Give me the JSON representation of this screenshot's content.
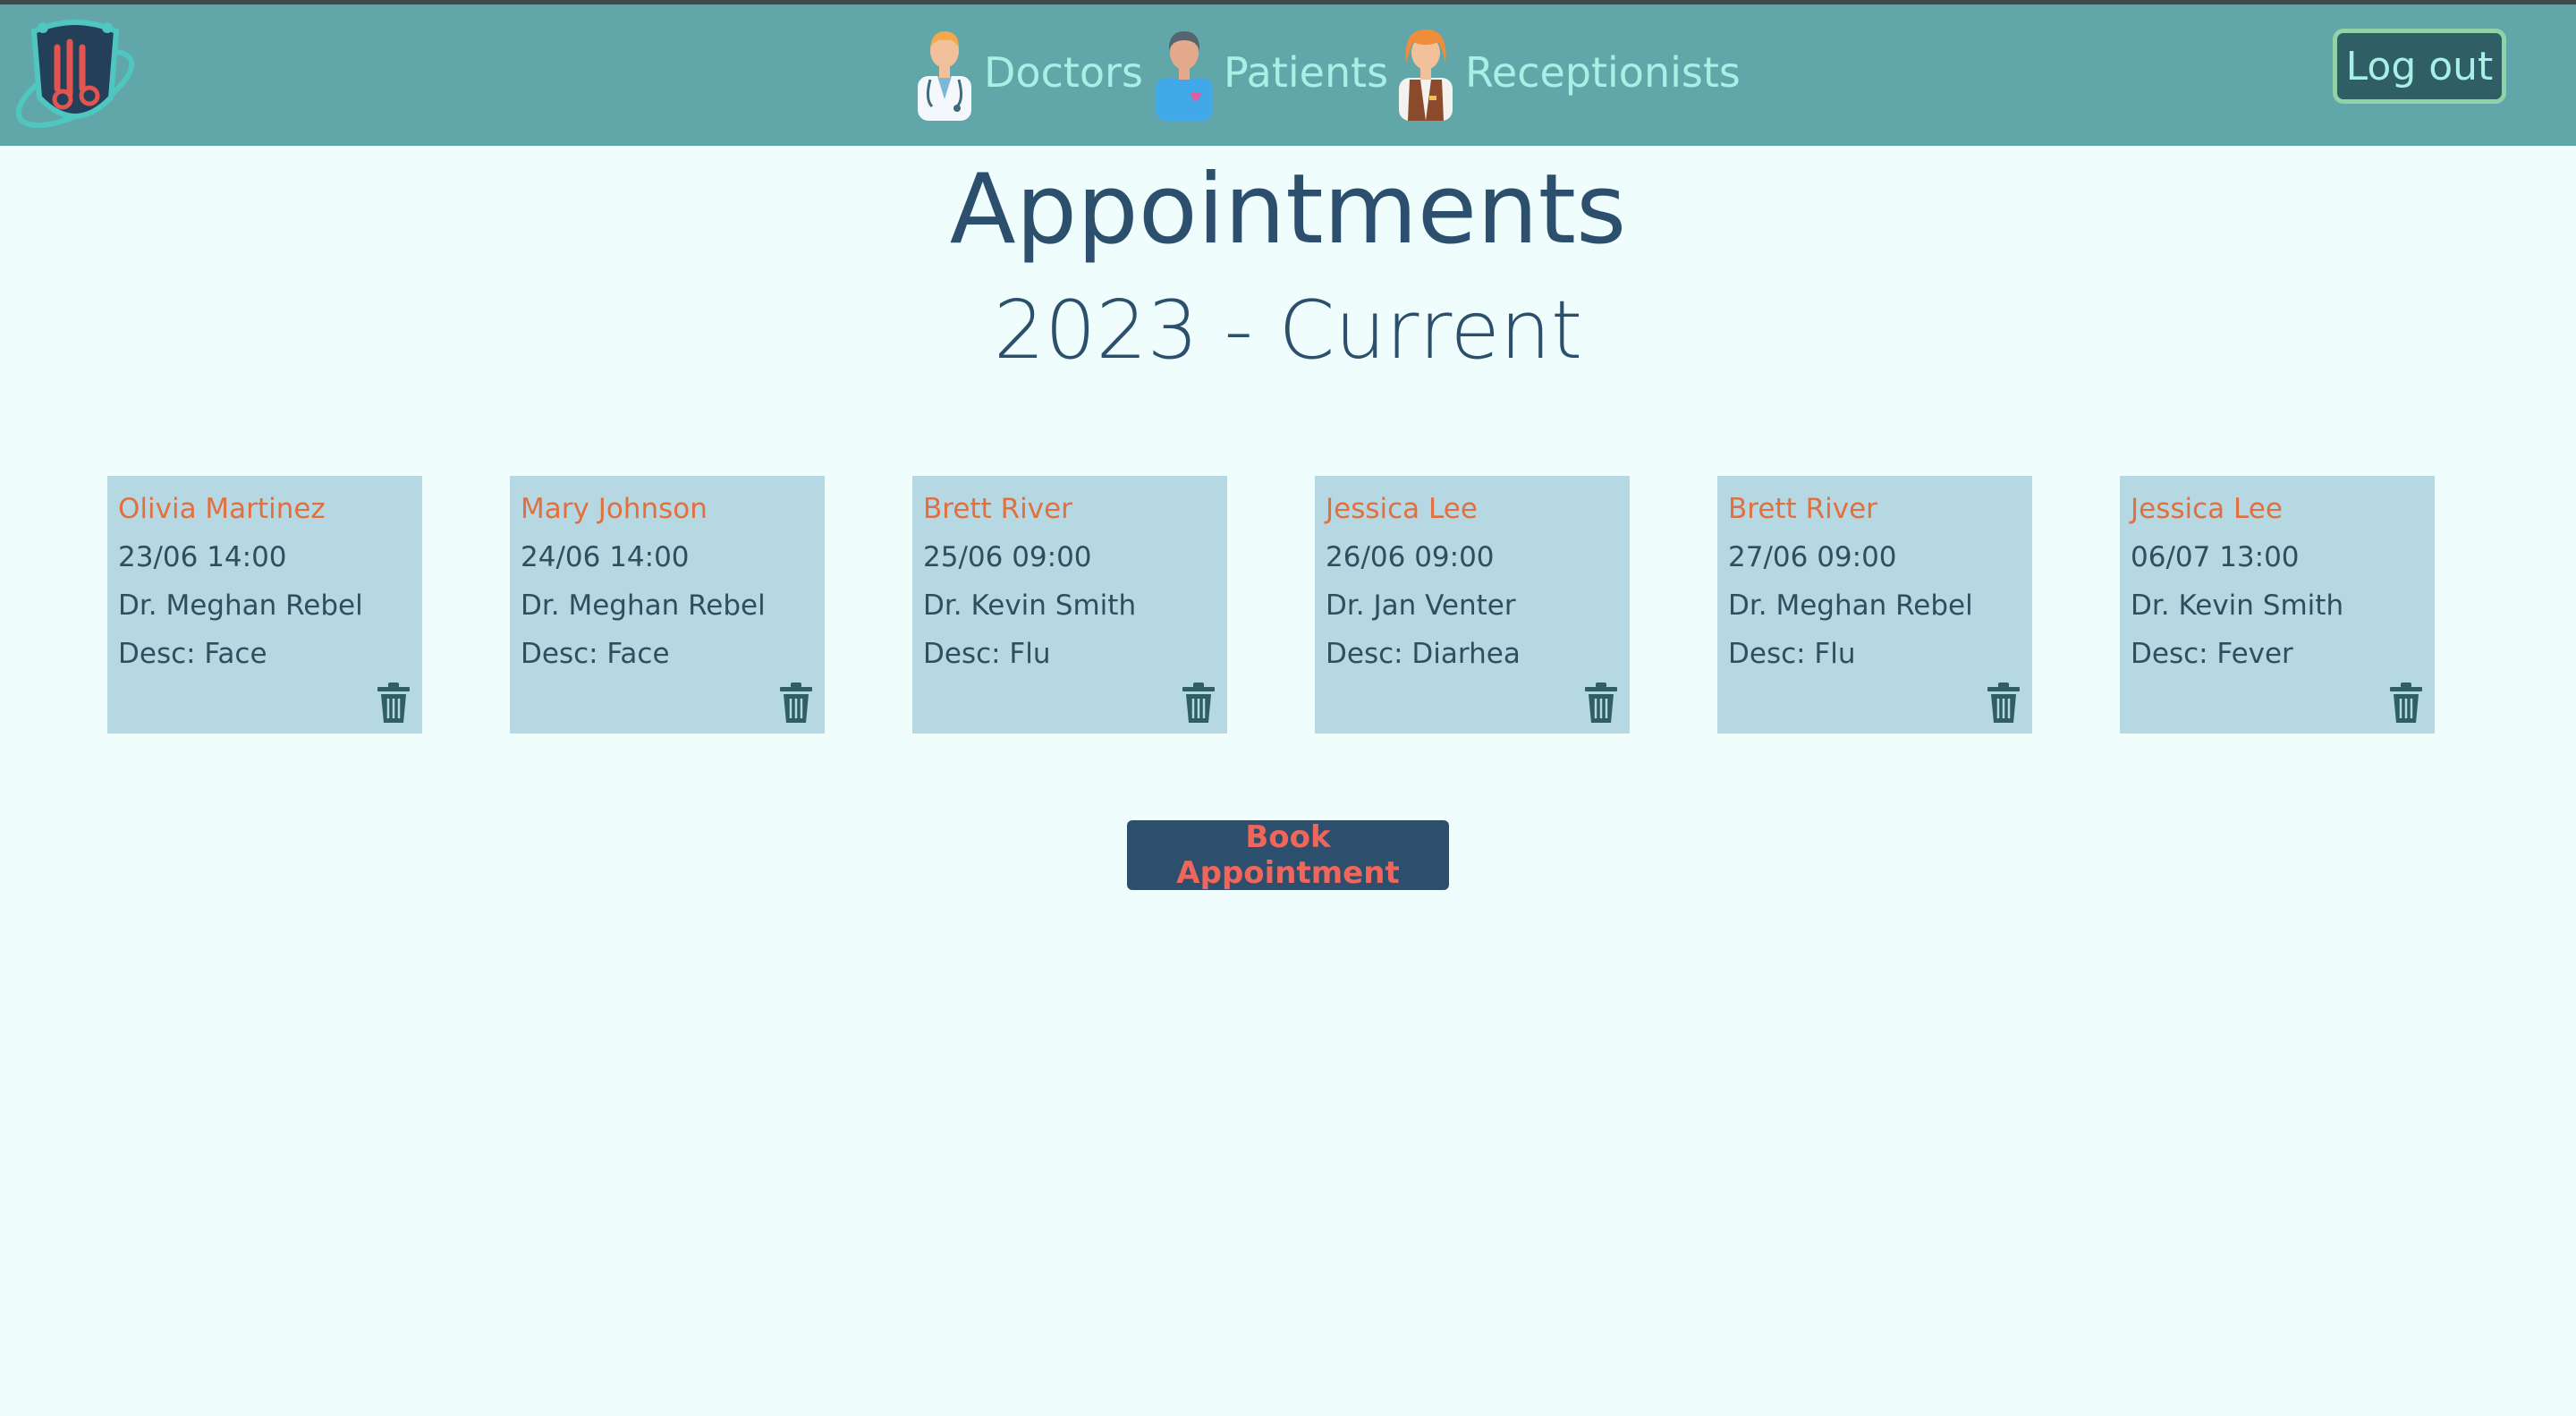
{
  "nav": {
    "items": [
      {
        "label": "Doctors",
        "icon": "doctor-icon"
      },
      {
        "label": "Patients",
        "icon": "patient-icon"
      },
      {
        "label": "Receptionists",
        "icon": "receptionist-icon"
      }
    ],
    "logout_label": "Log out"
  },
  "page": {
    "title": "Appointments",
    "subtitle": "2023 - Current"
  },
  "appointments": [
    {
      "patient": "Olivia Martinez",
      "datetime": "23/06 14:00",
      "doctor": "Dr. Meghan Rebel",
      "desc": "Desc: Face"
    },
    {
      "patient": "Mary Johnson",
      "datetime": "24/06 14:00",
      "doctor": "Dr. Meghan Rebel",
      "desc": "Desc: Face"
    },
    {
      "patient": "Brett River",
      "datetime": "25/06 09:00",
      "doctor": "Dr. Kevin Smith",
      "desc": "Desc: Flu"
    },
    {
      "patient": "Jessica Lee",
      "datetime": "26/06 09:00",
      "doctor": "Dr. Jan Venter",
      "desc": "Desc: Diarhea"
    },
    {
      "patient": "Brett River",
      "datetime": "27/06 09:00",
      "doctor": "Dr. Meghan Rebel",
      "desc": "Desc: Flu"
    },
    {
      "patient": "Jessica Lee",
      "datetime": "06/07 13:00",
      "doctor": "Dr. Kevin Smith",
      "desc": "Desc: Fever"
    }
  ],
  "book_button_label": "Book Appointment",
  "colors": {
    "navbar": "#61a6a8",
    "background": "#effefd",
    "card": "#b6d8e3",
    "patient_name": "#e2703f",
    "heading": "#2b4f6c",
    "button": "#2c4f6d",
    "button_text": "#f0665a"
  }
}
